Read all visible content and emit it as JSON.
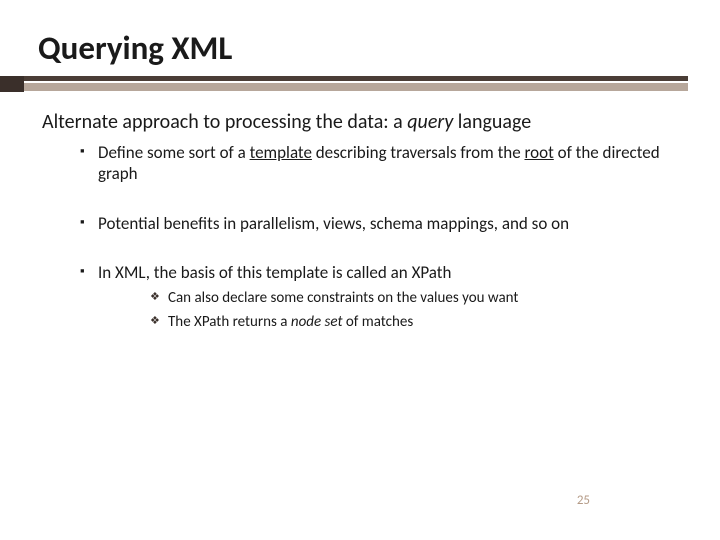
{
  "title": "Querying XML",
  "lead_pre": "Alternate approach to processing the data:  a ",
  "lead_em": "query",
  "lead_post": " language",
  "b1_pre": "Define some sort of a ",
  "b1_u1": "template",
  "b1_mid": " describing traversals from the ",
  "b1_u2": "root",
  "b1_post": " of the directed graph",
  "b2": "Potential benefits in parallelism, views, schema mappings, and so on",
  "b3": "In XML, the basis of this template is called an XPath",
  "b3a": "Can also declare some constraints on the values you want",
  "b3b_pre": "The XPath returns a ",
  "b3b_em": "node set",
  "b3b_post": " of matches",
  "pagenum": "25"
}
